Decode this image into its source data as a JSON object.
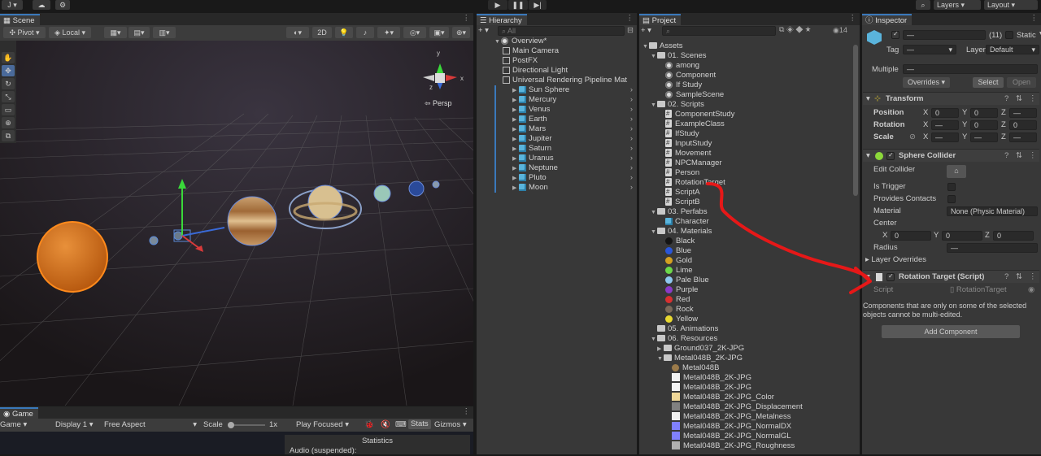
{
  "toolbar": {
    "account": "J",
    "play_icon": "play-icon",
    "layers": "Layers",
    "layout": "Layout"
  },
  "scene": {
    "tab": "Scene",
    "pivot": "Pivot",
    "local": "Local",
    "mode2d": "2D",
    "persp": "Persp"
  },
  "game": {
    "tab": "Game",
    "display_mode": "Game",
    "display": "Display 1",
    "aspect": "Free Aspect",
    "scale_label": "Scale",
    "scale_value": "1x",
    "play_focused": "Play Focused",
    "stats": "Stats",
    "gizmos": "Gizmos",
    "statistics_title": "Statistics",
    "audio": "Audio (suspended):"
  },
  "hierarchy": {
    "tab": "Hierarchy",
    "search_placeholder": "All",
    "root": "Overview*",
    "items": [
      "Main Camera",
      "PostFX",
      "Directional Light",
      "Universal Rendering Pipeline Mat"
    ],
    "planets": [
      "Sun Sphere",
      "Mercury",
      "Venus",
      "Earth",
      "Mars",
      "Jupiter",
      "Saturn",
      "Uranus",
      "Neptune",
      "Pluto",
      "Moon"
    ]
  },
  "project": {
    "tab": "Project",
    "count": "14",
    "assets": "Assets",
    "scenes_folder": "01. Scenes",
    "scenes": [
      "among",
      "Component",
      "If Study",
      "SampleScene"
    ],
    "scripts_folder": "02. Scripts",
    "scripts": [
      "ComponentStudy",
      "ExampleClass",
      "IfStudy",
      "InputStudy",
      "Movement",
      "NPCManager",
      "Person",
      "RotationTarget",
      "ScriptA",
      "ScriptB"
    ],
    "perfabs_folder": "03. Perfabs",
    "perfabs": [
      "Character"
    ],
    "materials_folder": "04. Materials",
    "materials": [
      {
        "name": "Black",
        "color": "#151515"
      },
      {
        "name": "Blue",
        "color": "#2a56d8"
      },
      {
        "name": "Gold",
        "color": "#d4a020"
      },
      {
        "name": "Lime",
        "color": "#6cd84a"
      },
      {
        "name": "Pale Blue",
        "color": "#8ec8f0"
      },
      {
        "name": "Purple",
        "color": "#8a3ac8"
      },
      {
        "name": "Red",
        "color": "#d83030"
      },
      {
        "name": "Rock",
        "color": "#7a6a5a"
      },
      {
        "name": "Yellow",
        "color": "#e8d830"
      }
    ],
    "animations_folder": "05. Animations",
    "resources_folder": "06. Resources",
    "resources": [
      "Ground037_2K-JPG",
      "Metal048B_2K-JPG"
    ],
    "textures": [
      {
        "name": "Metal048B",
        "color": "#9a7a4a"
      },
      {
        "name": "Metal048B_2K-JPG",
        "color": "#f0f0f0"
      },
      {
        "name": "Metal048B_2K-JPG",
        "color": "#f4f4f4"
      },
      {
        "name": "Metal048B_2K-JPG_Color",
        "color": "#f0d898"
      },
      {
        "name": "Metal048B_2K-JPG_Displacement",
        "color": "#808080"
      },
      {
        "name": "Metal048B_2K-JPG_Metalness",
        "color": "#f0f0f0"
      },
      {
        "name": "Metal048B_2K-JPG_NormalDX",
        "color": "#8080ff"
      },
      {
        "name": "Metal048B_2K-JPG_NormalGL",
        "color": "#8080ff"
      },
      {
        "name": "Metal048B_2K-JPG_Roughness",
        "color": "#b0b0b0"
      }
    ]
  },
  "inspector": {
    "tab": "Inspector",
    "name": "—",
    "count": "(11)",
    "static": "Static",
    "tag_label": "Tag",
    "tag_value": "—",
    "layer_label": "Layer",
    "layer_value": "Default",
    "multiple": "Multiple",
    "multiple_value": "—",
    "overrides": "Overrides",
    "select": "Select",
    "open": "Open",
    "transform": {
      "title": "Transform",
      "position": "Position",
      "rotation": "Rotation",
      "scale": "Scale",
      "x": "X",
      "y": "Y",
      "z": "Z",
      "pos": [
        "0",
        "0",
        "—"
      ],
      "rot": [
        "—",
        "0",
        "0"
      ],
      "scl": [
        "—",
        "—",
        "—"
      ]
    },
    "sphere_collider": {
      "title": "Sphere Collider",
      "edit_collider": "Edit Collider",
      "is_trigger": "Is Trigger",
      "provides_contacts": "Provides Contacts",
      "material": "Material",
      "material_value": "None (Physic Material)",
      "center": "Center",
      "center_values": [
        "0",
        "0",
        "0"
      ],
      "radius": "Radius",
      "radius_value": "—",
      "layer_overrides": "Layer Overrides"
    },
    "rotation_target": {
      "title": "Rotation Target (Script)",
      "script_label": "Script",
      "script_value": "RotationTarget"
    },
    "note": "Components that are only on some of the selected objects cannot be multi-edited.",
    "add_component": "Add Component"
  }
}
